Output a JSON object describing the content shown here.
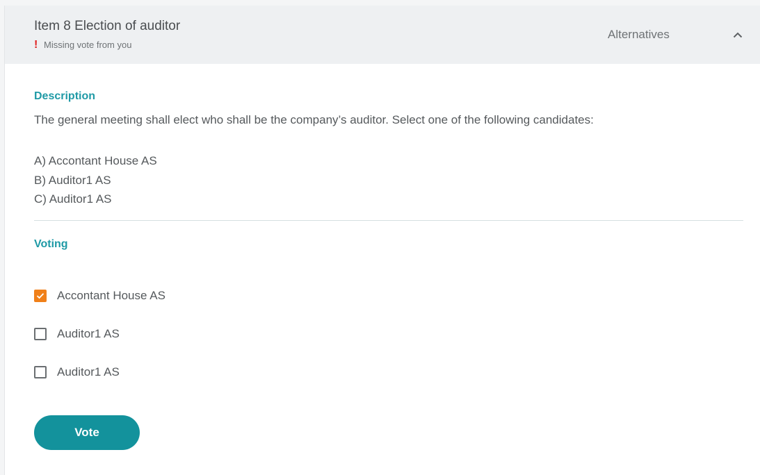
{
  "header": {
    "title": "Item 8 Election of auditor",
    "warning_icon": "!",
    "warning_text": "Missing vote from you",
    "alternatives_label": "Alternatives",
    "collapse_icon": "chevron-up-icon"
  },
  "description": {
    "heading": "Description",
    "text": "The general meeting shall elect who shall be the company’s auditor. Select one of the following candidates:",
    "candidates": [
      "A) Accontant House AS",
      "B) Auditor1 AS",
      "C) Auditor1 AS"
    ]
  },
  "voting": {
    "heading": "Voting",
    "options": [
      {
        "label": "Accontant House AS",
        "checked": true
      },
      {
        "label": "Auditor1 AS",
        "checked": false
      },
      {
        "label": "Auditor1 AS",
        "checked": false
      }
    ],
    "vote_label": "Vote"
  },
  "colors": {
    "accent": "#1f9aa6",
    "button": "#13929c",
    "checked": "#f08019",
    "warning": "#e02020",
    "header_bg": "#eef0f2"
  }
}
